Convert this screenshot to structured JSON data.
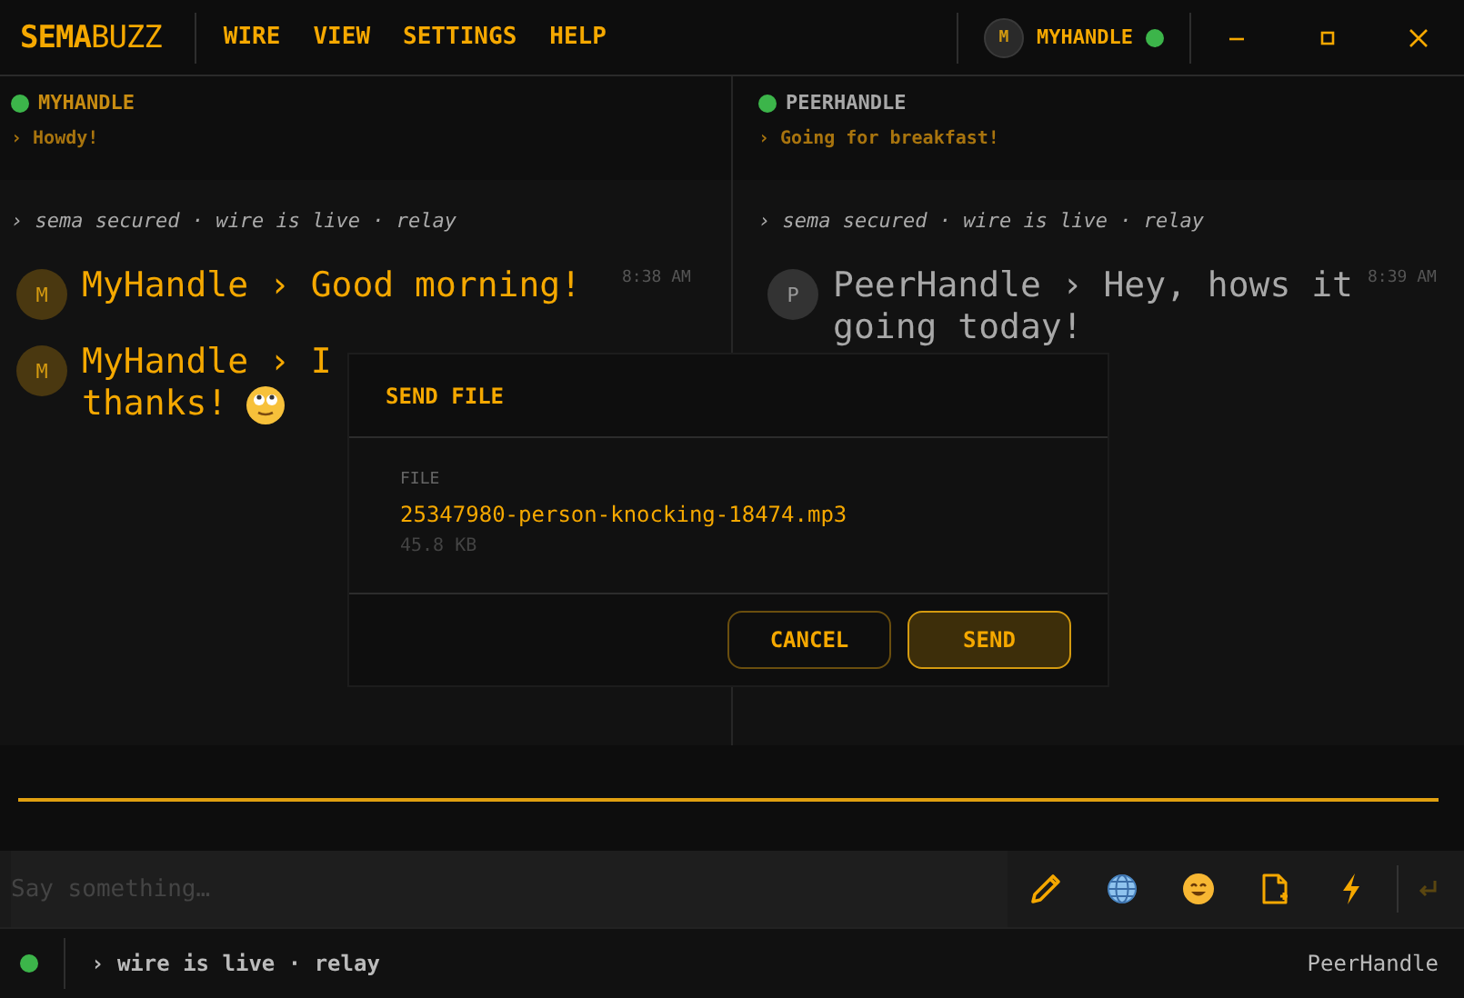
{
  "app": {
    "logo": "**SEMA**BUZZ"
  },
  "menu": [
    {
      "label": "WIRE"
    },
    {
      "label": "VIEW"
    },
    {
      "label": "SETTINGS"
    },
    {
      "label": "HELP"
    }
  ],
  "user": {
    "avatar": "M",
    "handle": "MYHANDLE",
    "online": true
  },
  "panes": [
    {
      "kind": "self",
      "handle": "MYHANDLE",
      "online": true,
      "status": "› Howdy!",
      "notice": "› sema secured · wire is live · relay",
      "messages": [
        {
          "avatar": "M",
          "lines": [
            "MyHandle › Good morning!"
          ],
          "time": "8:38 AM",
          "emoji": false
        },
        {
          "avatar": "M",
          "lines": [
            "MyHandle › I",
            "thanks!"
          ],
          "emoji": true
        }
      ]
    },
    {
      "kind": "peer",
      "handle": "PEERHANDLE",
      "online": true,
      "status": "› Going for breakfast!",
      "notice": "› sema secured · wire is live · relay",
      "messages": [
        {
          "avatar": "P",
          "lines": [
            "PeerHandle › Hey, hows it",
            "going today!"
          ],
          "time": "8:39 AM",
          "emoji": false
        }
      ]
    }
  ],
  "composer": {
    "placeholder": "Say something…",
    "send_disabled": true
  },
  "status_bar": {
    "online": true,
    "text": "› wire is live · relay",
    "peer": "PeerHandle"
  },
  "dialog": {
    "title": "SEND FILE",
    "field_label": "FILE",
    "file_name": "25347980-person-knocking-18474.mp3",
    "file_size": "45.8 KB",
    "buttons": [
      {
        "label": "CANCEL",
        "primary": false
      },
      {
        "label": "SEND",
        "primary": true
      }
    ]
  }
}
